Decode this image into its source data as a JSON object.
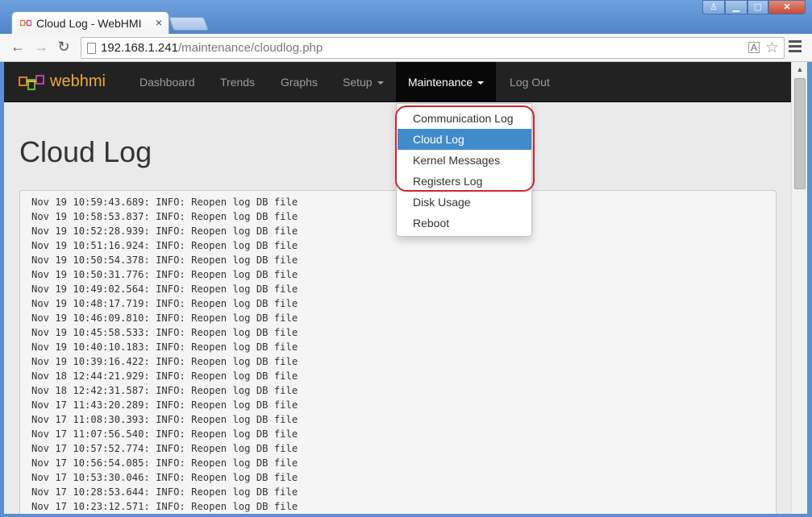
{
  "window": {
    "tab_title": "Cloud Log - WebHMI",
    "tab_close": "×",
    "user_glyph": "♙",
    "min_glyph": "▁",
    "max_glyph": "▢",
    "close_glyph": "✕"
  },
  "toolbar": {
    "back_glyph": "←",
    "forward_glyph": "→",
    "reload_glyph": "↻",
    "url_host": "192.168.1.241",
    "url_path": "/maintenance/cloudlog.php",
    "translate_glyph": "A",
    "star_glyph": "☆"
  },
  "navbar": {
    "brand": "webhmi",
    "items": [
      {
        "label": "Dashboard"
      },
      {
        "label": "Trends"
      },
      {
        "label": "Graphs"
      },
      {
        "label": "Setup"
      },
      {
        "label": "Maintenance"
      },
      {
        "label": "Log Out"
      }
    ]
  },
  "page": {
    "title": "Cloud Log"
  },
  "dropdown": {
    "items": [
      {
        "label": "Communication Log",
        "active": false
      },
      {
        "label": "Cloud Log",
        "active": true
      },
      {
        "label": "Kernel Messages",
        "active": false
      },
      {
        "label": "Registers Log",
        "active": false
      },
      {
        "label": "Disk Usage",
        "active": false
      },
      {
        "label": "Reboot",
        "active": false
      }
    ],
    "highlight_color": "#d02531",
    "active_color": "#428bca"
  },
  "log": {
    "lines": [
      "Nov 19 10:59:43.689: INFO: Reopen log DB file",
      "Nov 19 10:58:53.837: INFO: Reopen log DB file",
      "Nov 19 10:52:28.939: INFO: Reopen log DB file",
      "Nov 19 10:51:16.924: INFO: Reopen log DB file",
      "Nov 19 10:50:54.378: INFO: Reopen log DB file",
      "Nov 19 10:50:31.776: INFO: Reopen log DB file",
      "Nov 19 10:49:02.564: INFO: Reopen log DB file",
      "Nov 19 10:48:17.719: INFO: Reopen log DB file",
      "Nov 19 10:46:09.810: INFO: Reopen log DB file",
      "Nov 19 10:45:58.533: INFO: Reopen log DB file",
      "Nov 19 10:40:10.183: INFO: Reopen log DB file",
      "Nov 19 10:39:16.422: INFO: Reopen log DB file",
      "Nov 18 12:44:21.929: INFO: Reopen log DB file",
      "Nov 18 12:42:31.587: INFO: Reopen log DB file",
      "Nov 17 11:43:20.289: INFO: Reopen log DB file",
      "Nov 17 11:08:30.393: INFO: Reopen log DB file",
      "Nov 17 11:07:56.540: INFO: Reopen log DB file",
      "Nov 17 10:57:52.774: INFO: Reopen log DB file",
      "Nov 17 10:56:54.085: INFO: Reopen log DB file",
      "Nov 17 10:53:30.046: INFO: Reopen log DB file",
      "Nov 17 10:28:53.644: INFO: Reopen log DB file",
      "Nov 17 10:23:12.571: INFO: Reopen log DB file"
    ]
  },
  "scrollbar": {
    "up_glyph": "▲"
  }
}
